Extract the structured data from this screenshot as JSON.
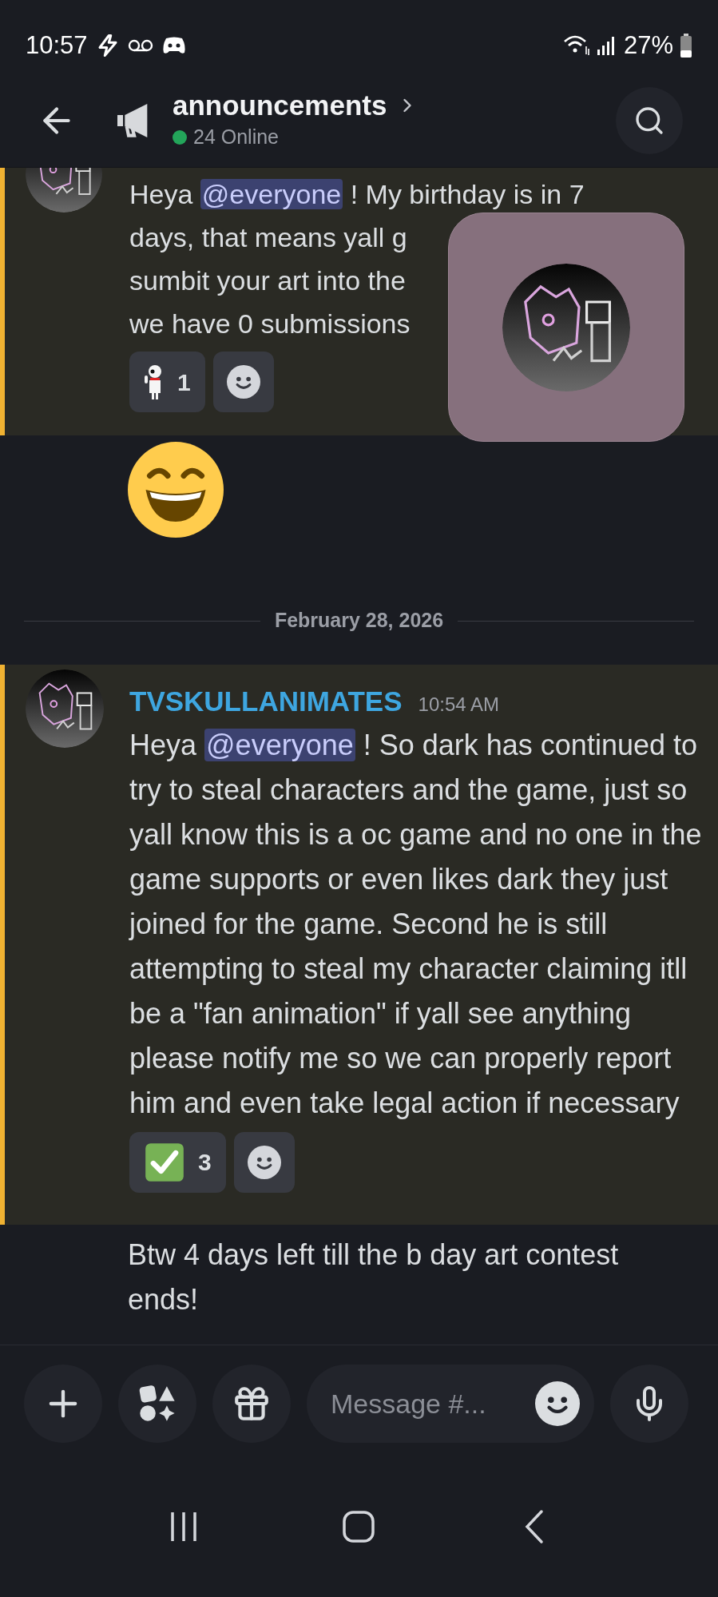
{
  "status_bar": {
    "time": "10:57",
    "battery": "27%"
  },
  "header": {
    "channel": "announcements",
    "online": "24 Online"
  },
  "earlier_message": {
    "lines": [
      {
        "before": "Heya",
        "mention": "@everyone",
        "after": "! My birthday is in 7"
      },
      {
        "text": "days, that means yall g"
      },
      {
        "text": "sumbit your art into the"
      },
      {
        "text": "we have 0 submissions"
      }
    ],
    "reactions": [
      {
        "kind": "figure",
        "count": "1"
      }
    ]
  },
  "date_divider": "February 28, 2026",
  "post": {
    "author": "TVSKULLANIMATES",
    "time": "10:54 AM",
    "before": "Heya",
    "mention": "@everyone",
    "text": "! So dark has continued to try to steal characters and the game, just so yall know this is a oc game and no one in the game supports or even likes dark they just joined for the game. Second he is still attempting to steal my character claiming itll be a \"fan animation\" if yall see anything please notify me so we can properly report him and even take legal action if necessary",
    "reactions": [
      {
        "kind": "check",
        "count": "3"
      }
    ]
  },
  "followup": "Btw 4 days left till the b day art contest ends!",
  "composer": {
    "placeholder": "Message #..."
  }
}
